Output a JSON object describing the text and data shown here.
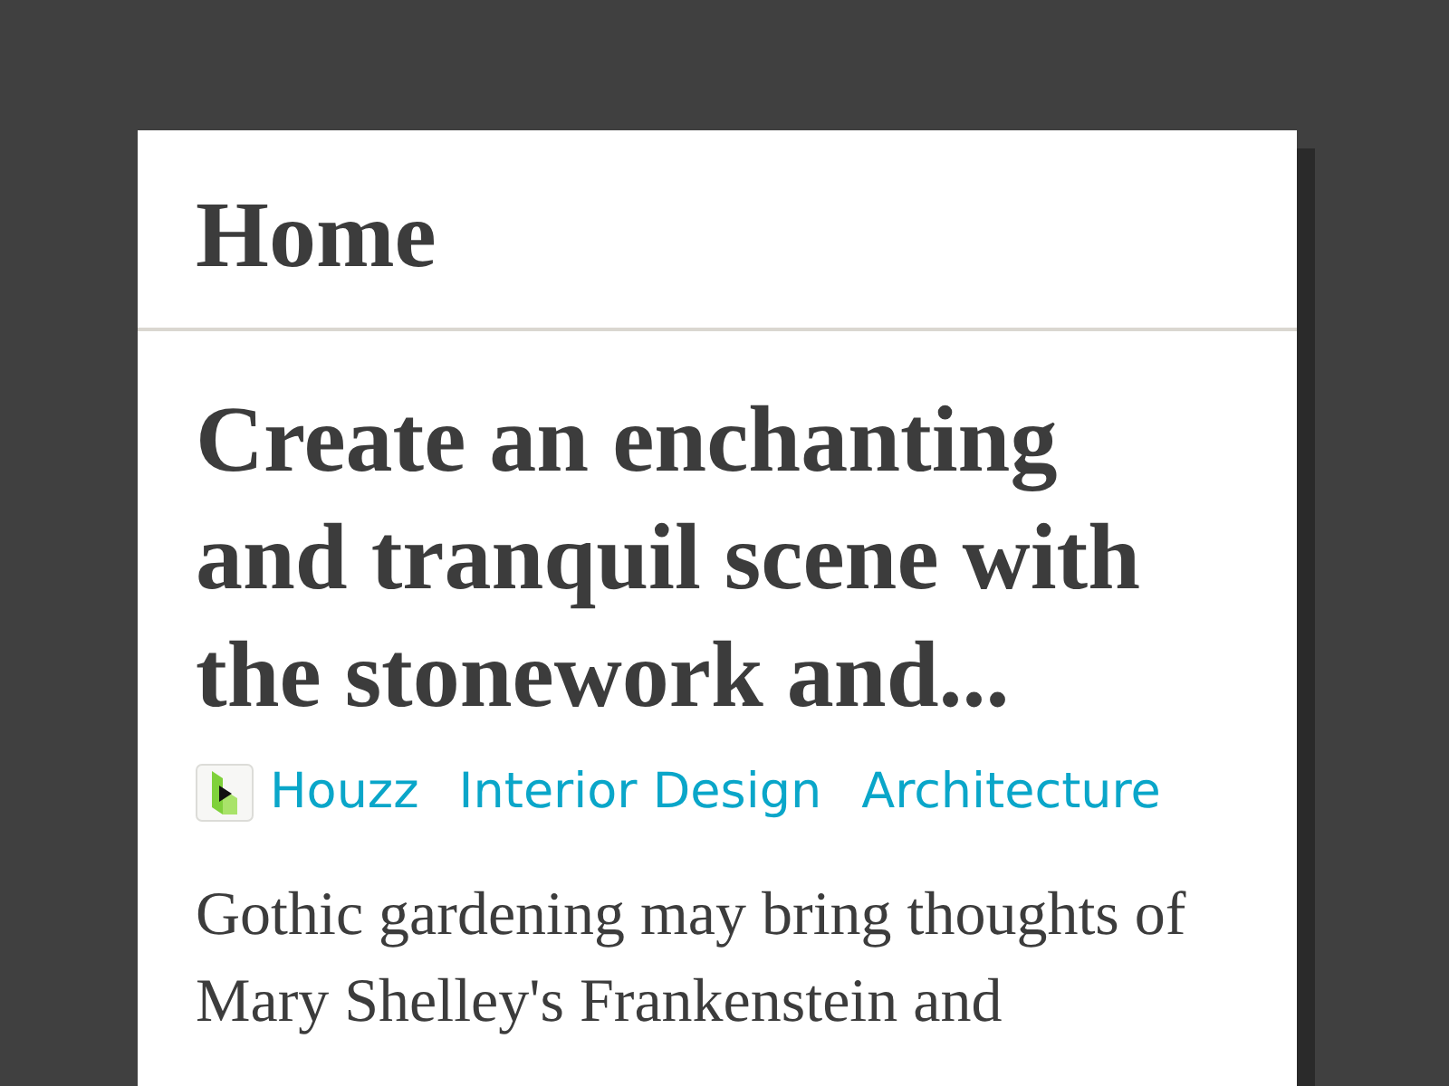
{
  "header": {
    "title": "Home"
  },
  "article": {
    "title": "Create an enchanting and tranquil scene with the stonework and...",
    "tags": [
      {
        "kind": "source",
        "label": "Houzz"
      },
      {
        "kind": "category",
        "label": "Interior Design"
      },
      {
        "kind": "category",
        "label": "Architecture"
      }
    ],
    "excerpt": "Gothic gardening may bring thoughts of Mary Shelley's Frankenstein and"
  }
}
